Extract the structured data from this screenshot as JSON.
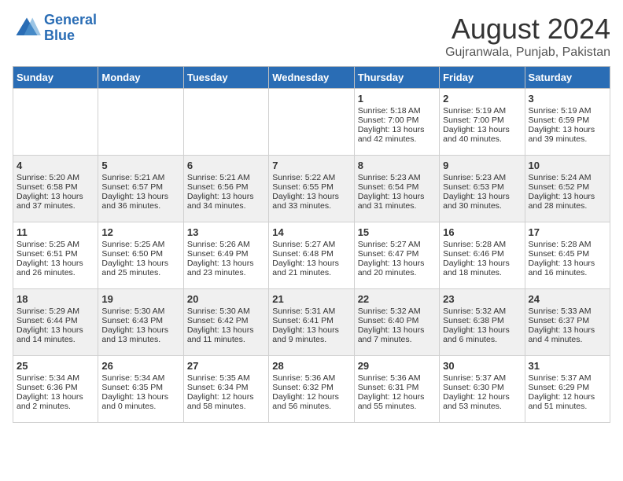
{
  "header": {
    "logo_general": "General",
    "logo_blue": "Blue",
    "title": "August 2024",
    "subtitle": "Gujranwala, Punjab, Pakistan"
  },
  "days_of_week": [
    "Sunday",
    "Monday",
    "Tuesday",
    "Wednesday",
    "Thursday",
    "Friday",
    "Saturday"
  ],
  "weeks": [
    [
      {
        "day": "",
        "sunrise": "",
        "sunset": "",
        "daylight": ""
      },
      {
        "day": "",
        "sunrise": "",
        "sunset": "",
        "daylight": ""
      },
      {
        "day": "",
        "sunrise": "",
        "sunset": "",
        "daylight": ""
      },
      {
        "day": "",
        "sunrise": "",
        "sunset": "",
        "daylight": ""
      },
      {
        "day": "1",
        "sunrise": "Sunrise: 5:18 AM",
        "sunset": "Sunset: 7:00 PM",
        "daylight": "Daylight: 13 hours and 42 minutes."
      },
      {
        "day": "2",
        "sunrise": "Sunrise: 5:19 AM",
        "sunset": "Sunset: 7:00 PM",
        "daylight": "Daylight: 13 hours and 40 minutes."
      },
      {
        "day": "3",
        "sunrise": "Sunrise: 5:19 AM",
        "sunset": "Sunset: 6:59 PM",
        "daylight": "Daylight: 13 hours and 39 minutes."
      }
    ],
    [
      {
        "day": "4",
        "sunrise": "Sunrise: 5:20 AM",
        "sunset": "Sunset: 6:58 PM",
        "daylight": "Daylight: 13 hours and 37 minutes."
      },
      {
        "day": "5",
        "sunrise": "Sunrise: 5:21 AM",
        "sunset": "Sunset: 6:57 PM",
        "daylight": "Daylight: 13 hours and 36 minutes."
      },
      {
        "day": "6",
        "sunrise": "Sunrise: 5:21 AM",
        "sunset": "Sunset: 6:56 PM",
        "daylight": "Daylight: 13 hours and 34 minutes."
      },
      {
        "day": "7",
        "sunrise": "Sunrise: 5:22 AM",
        "sunset": "Sunset: 6:55 PM",
        "daylight": "Daylight: 13 hours and 33 minutes."
      },
      {
        "day": "8",
        "sunrise": "Sunrise: 5:23 AM",
        "sunset": "Sunset: 6:54 PM",
        "daylight": "Daylight: 13 hours and 31 minutes."
      },
      {
        "day": "9",
        "sunrise": "Sunrise: 5:23 AM",
        "sunset": "Sunset: 6:53 PM",
        "daylight": "Daylight: 13 hours and 30 minutes."
      },
      {
        "day": "10",
        "sunrise": "Sunrise: 5:24 AM",
        "sunset": "Sunset: 6:52 PM",
        "daylight": "Daylight: 13 hours and 28 minutes."
      }
    ],
    [
      {
        "day": "11",
        "sunrise": "Sunrise: 5:25 AM",
        "sunset": "Sunset: 6:51 PM",
        "daylight": "Daylight: 13 hours and 26 minutes."
      },
      {
        "day": "12",
        "sunrise": "Sunrise: 5:25 AM",
        "sunset": "Sunset: 6:50 PM",
        "daylight": "Daylight: 13 hours and 25 minutes."
      },
      {
        "day": "13",
        "sunrise": "Sunrise: 5:26 AM",
        "sunset": "Sunset: 6:49 PM",
        "daylight": "Daylight: 13 hours and 23 minutes."
      },
      {
        "day": "14",
        "sunrise": "Sunrise: 5:27 AM",
        "sunset": "Sunset: 6:48 PM",
        "daylight": "Daylight: 13 hours and 21 minutes."
      },
      {
        "day": "15",
        "sunrise": "Sunrise: 5:27 AM",
        "sunset": "Sunset: 6:47 PM",
        "daylight": "Daylight: 13 hours and 20 minutes."
      },
      {
        "day": "16",
        "sunrise": "Sunrise: 5:28 AM",
        "sunset": "Sunset: 6:46 PM",
        "daylight": "Daylight: 13 hours and 18 minutes."
      },
      {
        "day": "17",
        "sunrise": "Sunrise: 5:28 AM",
        "sunset": "Sunset: 6:45 PM",
        "daylight": "Daylight: 13 hours and 16 minutes."
      }
    ],
    [
      {
        "day": "18",
        "sunrise": "Sunrise: 5:29 AM",
        "sunset": "Sunset: 6:44 PM",
        "daylight": "Daylight: 13 hours and 14 minutes."
      },
      {
        "day": "19",
        "sunrise": "Sunrise: 5:30 AM",
        "sunset": "Sunset: 6:43 PM",
        "daylight": "Daylight: 13 hours and 13 minutes."
      },
      {
        "day": "20",
        "sunrise": "Sunrise: 5:30 AM",
        "sunset": "Sunset: 6:42 PM",
        "daylight": "Daylight: 13 hours and 11 minutes."
      },
      {
        "day": "21",
        "sunrise": "Sunrise: 5:31 AM",
        "sunset": "Sunset: 6:41 PM",
        "daylight": "Daylight: 13 hours and 9 minutes."
      },
      {
        "day": "22",
        "sunrise": "Sunrise: 5:32 AM",
        "sunset": "Sunset: 6:40 PM",
        "daylight": "Daylight: 13 hours and 7 minutes."
      },
      {
        "day": "23",
        "sunrise": "Sunrise: 5:32 AM",
        "sunset": "Sunset: 6:38 PM",
        "daylight": "Daylight: 13 hours and 6 minutes."
      },
      {
        "day": "24",
        "sunrise": "Sunrise: 5:33 AM",
        "sunset": "Sunset: 6:37 PM",
        "daylight": "Daylight: 13 hours and 4 minutes."
      }
    ],
    [
      {
        "day": "25",
        "sunrise": "Sunrise: 5:34 AM",
        "sunset": "Sunset: 6:36 PM",
        "daylight": "Daylight: 13 hours and 2 minutes."
      },
      {
        "day": "26",
        "sunrise": "Sunrise: 5:34 AM",
        "sunset": "Sunset: 6:35 PM",
        "daylight": "Daylight: 13 hours and 0 minutes."
      },
      {
        "day": "27",
        "sunrise": "Sunrise: 5:35 AM",
        "sunset": "Sunset: 6:34 PM",
        "daylight": "Daylight: 12 hours and 58 minutes."
      },
      {
        "day": "28",
        "sunrise": "Sunrise: 5:36 AM",
        "sunset": "Sunset: 6:32 PM",
        "daylight": "Daylight: 12 hours and 56 minutes."
      },
      {
        "day": "29",
        "sunrise": "Sunrise: 5:36 AM",
        "sunset": "Sunset: 6:31 PM",
        "daylight": "Daylight: 12 hours and 55 minutes."
      },
      {
        "day": "30",
        "sunrise": "Sunrise: 5:37 AM",
        "sunset": "Sunset: 6:30 PM",
        "daylight": "Daylight: 12 hours and 53 minutes."
      },
      {
        "day": "31",
        "sunrise": "Sunrise: 5:37 AM",
        "sunset": "Sunset: 6:29 PM",
        "daylight": "Daylight: 12 hours and 51 minutes."
      }
    ]
  ]
}
